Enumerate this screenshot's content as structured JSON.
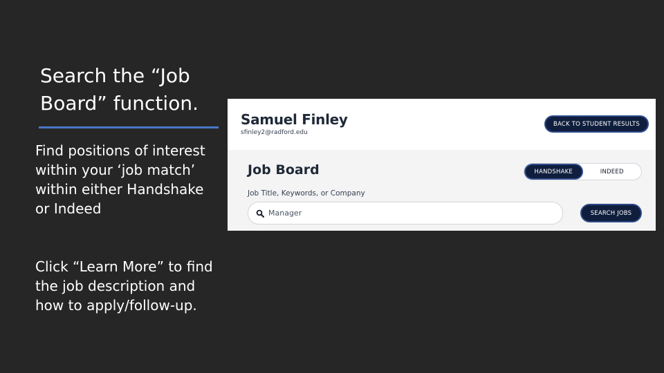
{
  "slide": {
    "title": "Search the “Job Board” function.",
    "bullet_1": "Find positions of interest within your ‘job match’ within either Handshake or Indeed",
    "bullet_2": "Click “Learn More” to find the job description and how to apply/follow-up."
  },
  "screenshot": {
    "student_name": "Samuel Finley",
    "student_email": "sfinley2@radford.edu",
    "back_button_label": "BACK TO STUDENT RESULTS",
    "board_title": "Job Board",
    "toggle": {
      "options": [
        "HANDSHAKE",
        "INDEED"
      ],
      "selected": "HANDSHAKE"
    },
    "search_label": "Job Title, Keywords, or Company",
    "search_value": "Manager",
    "search_button_label": "SEARCH JOBS",
    "icons": {
      "search": "search-icon"
    }
  },
  "colors": {
    "background": "#262626",
    "accent_rule": "#4a77c9",
    "button_navy": "#0f1e3c"
  }
}
